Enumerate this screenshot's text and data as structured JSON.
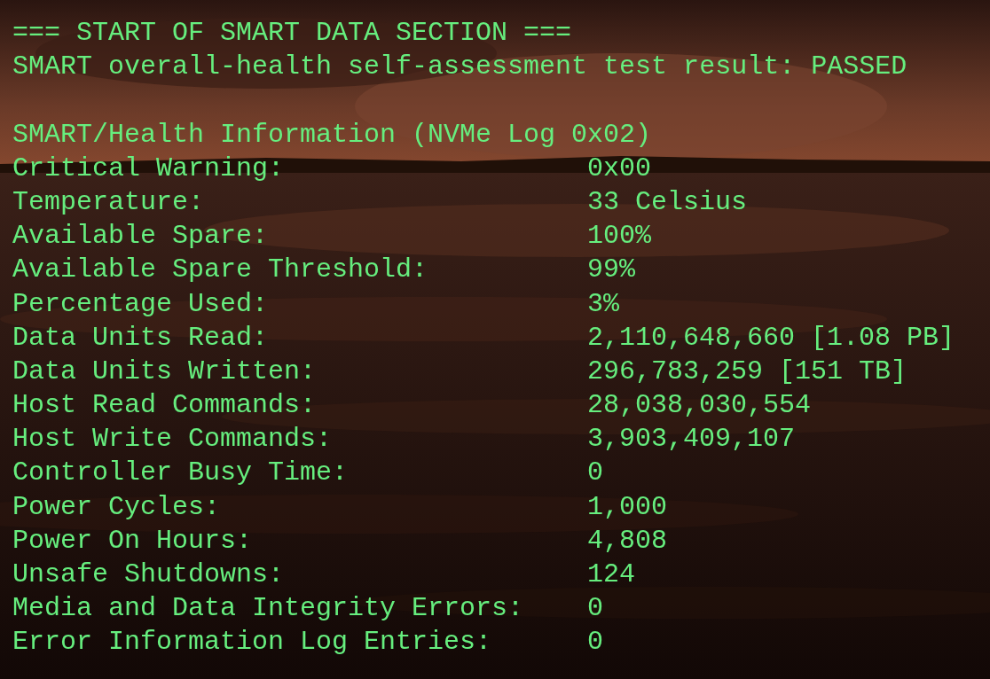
{
  "header_lines": [
    "=== START OF SMART DATA SECTION ===",
    "SMART overall-health self-assessment test result: PASSED"
  ],
  "section_title": "SMART/Health Information (NVMe Log 0x02)",
  "fields": [
    {
      "label": "Critical Warning:",
      "value": "0x00"
    },
    {
      "label": "Temperature:",
      "value": "33 Celsius"
    },
    {
      "label": "Available Spare:",
      "value": "100%"
    },
    {
      "label": "Available Spare Threshold:",
      "value": "99%"
    },
    {
      "label": "Percentage Used:",
      "value": "3%"
    },
    {
      "label": "Data Units Read:",
      "value": "2,110,648,660 [1.08 PB]"
    },
    {
      "label": "Data Units Written:",
      "value": "296,783,259 [151 TB]"
    },
    {
      "label": "Host Read Commands:",
      "value": "28,038,030,554"
    },
    {
      "label": "Host Write Commands:",
      "value": "3,903,409,107"
    },
    {
      "label": "Controller Busy Time:",
      "value": "0"
    },
    {
      "label": "Power Cycles:",
      "value": "1,000"
    },
    {
      "label": "Power On Hours:",
      "value": "4,808"
    },
    {
      "label": "Unsafe Shutdowns:",
      "value": "124"
    },
    {
      "label": "Media and Data Integrity Errors:",
      "value": "0"
    },
    {
      "label": "Error Information Log Entries:",
      "value": "0"
    }
  ]
}
